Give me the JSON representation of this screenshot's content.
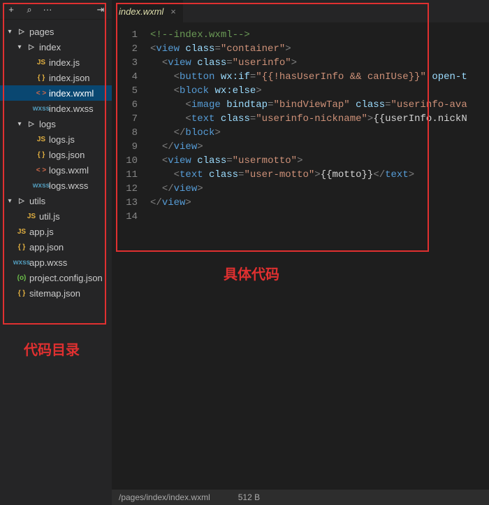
{
  "toolbar": {
    "add": "+",
    "search": "⌕",
    "more": "···",
    "collapse": "⇥"
  },
  "tree": [
    {
      "depth": 0,
      "twisty": "▾",
      "iconClass": "ic-folder",
      "icon": "▷",
      "label": "pages",
      "interact": true
    },
    {
      "depth": 1,
      "twisty": "▾",
      "iconClass": "ic-folder",
      "icon": "▷",
      "label": "index",
      "interact": true
    },
    {
      "depth": 2,
      "twisty": "",
      "iconClass": "ic-js",
      "icon": "JS",
      "label": "index.js",
      "interact": true
    },
    {
      "depth": 2,
      "twisty": "",
      "iconClass": "ic-json",
      "icon": "{ }",
      "label": "index.json",
      "interact": true
    },
    {
      "depth": 2,
      "twisty": "",
      "iconClass": "ic-wxml",
      "icon": "< >",
      "label": "index.wxml",
      "interact": true,
      "active": true
    },
    {
      "depth": 2,
      "twisty": "",
      "iconClass": "ic-wxss",
      "icon": "wxss",
      "label": "index.wxss",
      "interact": true
    },
    {
      "depth": 1,
      "twisty": "▾",
      "iconClass": "ic-folder",
      "icon": "▷",
      "label": "logs",
      "interact": true
    },
    {
      "depth": 2,
      "twisty": "",
      "iconClass": "ic-js",
      "icon": "JS",
      "label": "logs.js",
      "interact": true
    },
    {
      "depth": 2,
      "twisty": "",
      "iconClass": "ic-json",
      "icon": "{ }",
      "label": "logs.json",
      "interact": true
    },
    {
      "depth": 2,
      "twisty": "",
      "iconClass": "ic-wxml",
      "icon": "< >",
      "label": "logs.wxml",
      "interact": true
    },
    {
      "depth": 2,
      "twisty": "",
      "iconClass": "ic-wxss",
      "icon": "wxss",
      "label": "logs.wxss",
      "interact": true
    },
    {
      "depth": 0,
      "twisty": "▾",
      "iconClass": "ic-folder",
      "icon": "▷",
      "label": "utils",
      "interact": true
    },
    {
      "depth": 1,
      "twisty": "",
      "iconClass": "ic-js",
      "icon": "JS",
      "label": "util.js",
      "interact": true
    },
    {
      "depth": 0,
      "twisty": "",
      "iconClass": "ic-js",
      "icon": "JS",
      "label": "app.js",
      "interact": true
    },
    {
      "depth": 0,
      "twisty": "",
      "iconClass": "ic-json",
      "icon": "{ }",
      "label": "app.json",
      "interact": true
    },
    {
      "depth": 0,
      "twisty": "",
      "iconClass": "ic-wxss",
      "icon": "wxss",
      "label": "app.wxss",
      "interact": true
    },
    {
      "depth": 0,
      "twisty": "",
      "iconClass": "ic-cfg",
      "icon": "(o)",
      "label": "project.config.json",
      "interact": true
    },
    {
      "depth": 0,
      "twisty": "",
      "iconClass": "ic-json",
      "icon": "{ }",
      "label": "sitemap.json",
      "interact": true
    }
  ],
  "tab": {
    "title": "index.wxml",
    "close": "×"
  },
  "code": {
    "lines": [
      [
        {
          "c": "tk-comment",
          "t": "<!--index.wxml-->"
        }
      ],
      [
        {
          "c": "tk-punct",
          "t": "<"
        },
        {
          "c": "tk-tag",
          "t": "view"
        },
        {
          "c": "tk-txt",
          "t": " "
        },
        {
          "c": "tk-attr",
          "t": "class"
        },
        {
          "c": "tk-punct",
          "t": "="
        },
        {
          "c": "tk-str",
          "t": "\"container\""
        },
        {
          "c": "tk-punct",
          "t": ">"
        }
      ],
      [
        {
          "c": "tk-txt",
          "t": "  "
        },
        {
          "c": "tk-punct",
          "t": "<"
        },
        {
          "c": "tk-tag",
          "t": "view"
        },
        {
          "c": "tk-txt",
          "t": " "
        },
        {
          "c": "tk-attr",
          "t": "class"
        },
        {
          "c": "tk-punct",
          "t": "="
        },
        {
          "c": "tk-str",
          "t": "\"userinfo\""
        },
        {
          "c": "tk-punct",
          "t": ">"
        }
      ],
      [
        {
          "c": "tk-txt",
          "t": "    "
        },
        {
          "c": "tk-punct",
          "t": "<"
        },
        {
          "c": "tk-tag",
          "t": "button"
        },
        {
          "c": "tk-txt",
          "t": " "
        },
        {
          "c": "tk-attr",
          "t": "wx:if"
        },
        {
          "c": "tk-punct",
          "t": "="
        },
        {
          "c": "tk-str",
          "t": "\"{{!hasUserInfo && canIUse}}\""
        },
        {
          "c": "tk-txt",
          "t": " "
        },
        {
          "c": "tk-attr",
          "t": "open-t"
        }
      ],
      [
        {
          "c": "tk-txt",
          "t": "    "
        },
        {
          "c": "tk-punct",
          "t": "<"
        },
        {
          "c": "tk-tag",
          "t": "block"
        },
        {
          "c": "tk-txt",
          "t": " "
        },
        {
          "c": "tk-attr",
          "t": "wx:else"
        },
        {
          "c": "tk-punct",
          "t": ">"
        }
      ],
      [
        {
          "c": "tk-txt",
          "t": "      "
        },
        {
          "c": "tk-punct",
          "t": "<"
        },
        {
          "c": "tk-tag",
          "t": "image"
        },
        {
          "c": "tk-txt",
          "t": " "
        },
        {
          "c": "tk-attr",
          "t": "bindtap"
        },
        {
          "c": "tk-punct",
          "t": "="
        },
        {
          "c": "tk-str",
          "t": "\"bindViewTap\""
        },
        {
          "c": "tk-txt",
          "t": " "
        },
        {
          "c": "tk-attr",
          "t": "class"
        },
        {
          "c": "tk-punct",
          "t": "="
        },
        {
          "c": "tk-str",
          "t": "\"userinfo-ava"
        }
      ],
      [
        {
          "c": "tk-txt",
          "t": "      "
        },
        {
          "c": "tk-punct",
          "t": "<"
        },
        {
          "c": "tk-tag",
          "t": "text"
        },
        {
          "c": "tk-txt",
          "t": " "
        },
        {
          "c": "tk-attr",
          "t": "class"
        },
        {
          "c": "tk-punct",
          "t": "="
        },
        {
          "c": "tk-str",
          "t": "\"userinfo-nickname\""
        },
        {
          "c": "tk-punct",
          "t": ">"
        },
        {
          "c": "tk-txt",
          "t": "{{userInfo.nickN"
        }
      ],
      [
        {
          "c": "tk-txt",
          "t": "    "
        },
        {
          "c": "tk-punct",
          "t": "</"
        },
        {
          "c": "tk-tag",
          "t": "block"
        },
        {
          "c": "tk-punct",
          "t": ">"
        }
      ],
      [
        {
          "c": "tk-txt",
          "t": "  "
        },
        {
          "c": "tk-punct",
          "t": "</"
        },
        {
          "c": "tk-tag",
          "t": "view"
        },
        {
          "c": "tk-punct",
          "t": ">"
        }
      ],
      [
        {
          "c": "tk-txt",
          "t": "  "
        },
        {
          "c": "tk-punct",
          "t": "<"
        },
        {
          "c": "tk-tag",
          "t": "view"
        },
        {
          "c": "tk-txt",
          "t": " "
        },
        {
          "c": "tk-attr",
          "t": "class"
        },
        {
          "c": "tk-punct",
          "t": "="
        },
        {
          "c": "tk-str",
          "t": "\"usermotto\""
        },
        {
          "c": "tk-punct",
          "t": ">"
        }
      ],
      [
        {
          "c": "tk-txt",
          "t": "    "
        },
        {
          "c": "tk-punct",
          "t": "<"
        },
        {
          "c": "tk-tag",
          "t": "text"
        },
        {
          "c": "tk-txt",
          "t": " "
        },
        {
          "c": "tk-attr",
          "t": "class"
        },
        {
          "c": "tk-punct",
          "t": "="
        },
        {
          "c": "tk-str",
          "t": "\"user-motto\""
        },
        {
          "c": "tk-punct",
          "t": ">"
        },
        {
          "c": "tk-txt",
          "t": "{{motto}}"
        },
        {
          "c": "tk-punct",
          "t": "</"
        },
        {
          "c": "tk-tag",
          "t": "text"
        },
        {
          "c": "tk-punct",
          "t": ">"
        }
      ],
      [
        {
          "c": "tk-txt",
          "t": "  "
        },
        {
          "c": "tk-punct",
          "t": "</"
        },
        {
          "c": "tk-tag",
          "t": "view"
        },
        {
          "c": "tk-punct",
          "t": ">"
        }
      ],
      [
        {
          "c": "tk-punct",
          "t": "</"
        },
        {
          "c": "tk-tag",
          "t": "view"
        },
        {
          "c": "tk-punct",
          "t": ">"
        }
      ],
      []
    ]
  },
  "status": {
    "path": "/pages/index/index.wxml",
    "size": "512 B"
  },
  "annotations": {
    "sidebar": "代码目录",
    "editor": "具体代码"
  }
}
